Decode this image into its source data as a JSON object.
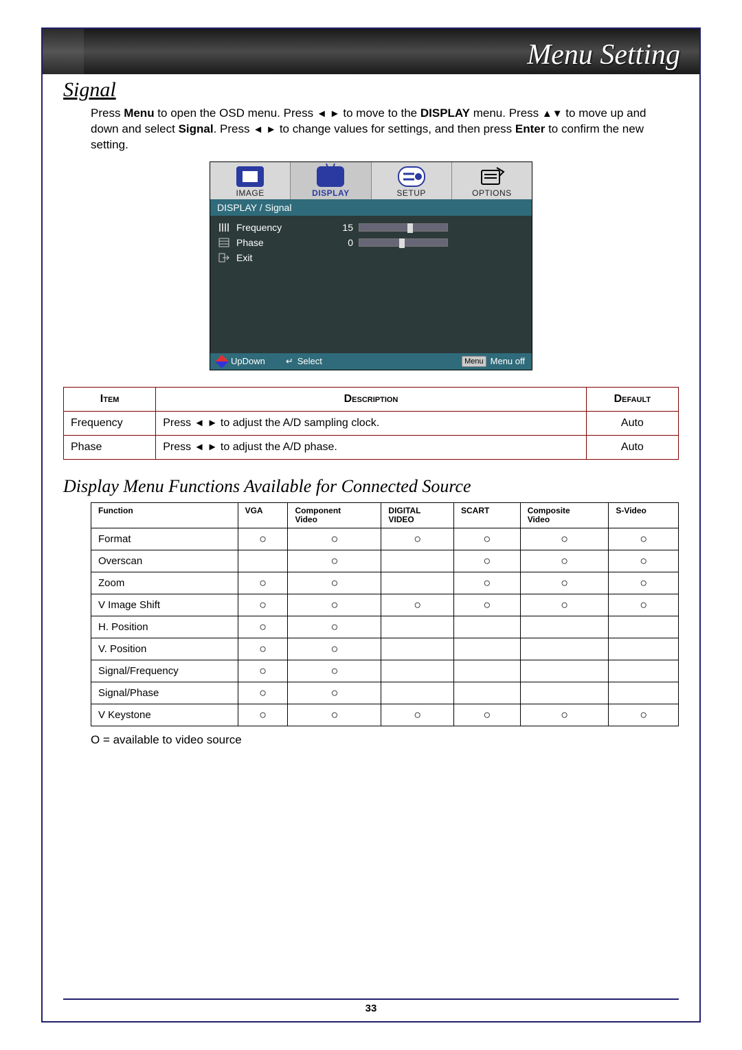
{
  "header": {
    "title": "Menu Setting"
  },
  "section": {
    "title": "Signal"
  },
  "intro": {
    "p1a": "Press ",
    "menu": "Menu",
    "p1b": " to open the OSD menu. Press ",
    "p1c": " to move to the ",
    "display": "DISPLAY",
    "p1d": " menu. Press ",
    "p1e": " to move up and down and select ",
    "signal": "Signal",
    "p1f": ". Press ",
    "p1g": " to change values for settings, and then press ",
    "enter": "Enter",
    "p1h": " to confirm the new setting."
  },
  "osd": {
    "tabs": [
      "IMAGE",
      "DISPLAY",
      "SETUP",
      "OPTIONS"
    ],
    "breadcrumb": "DISPLAY / Signal",
    "rows": [
      {
        "label": "Frequency",
        "value": "15",
        "thumb_pct": 55
      },
      {
        "label": "Phase",
        "value": "0",
        "thumb_pct": 45
      }
    ],
    "exit": "Exit",
    "footer": {
      "updown": "UpDown",
      "select": "Select",
      "menu_btn": "Menu",
      "menuoff": "Menu off"
    }
  },
  "desc_table": {
    "headers": [
      "Item",
      "Description",
      "Default"
    ],
    "rows": [
      {
        "item": "Frequency",
        "desc_a": "Press ",
        "desc_b": " to adjust the A/D sampling clock.",
        "def": "Auto"
      },
      {
        "item": "Phase",
        "desc_a": "Press ",
        "desc_b": " to adjust the A/D phase.",
        "def": "Auto"
      }
    ]
  },
  "subtitle": "Display Menu Functions Available for Connected Source",
  "avail_table": {
    "headers": [
      "Function",
      "VGA",
      "Component Video",
      "DIGITAL VIDEO",
      "SCART",
      "Composite Video",
      "S-Video"
    ],
    "rows": [
      {
        "fn": "Format",
        "cells": [
          "○",
          "○",
          "○",
          "○",
          "○",
          "○"
        ]
      },
      {
        "fn": "Overscan",
        "cells": [
          "",
          "○",
          "",
          "○",
          "○",
          "○"
        ]
      },
      {
        "fn": "Zoom",
        "cells": [
          "○",
          "○",
          "",
          "○",
          "○",
          "○"
        ]
      },
      {
        "fn": "V Image Shift",
        "cells": [
          "○",
          "○",
          "○",
          "○",
          "○",
          "○"
        ]
      },
      {
        "fn": "H. Position",
        "cells": [
          "○",
          "○",
          "",
          "",
          "",
          ""
        ]
      },
      {
        "fn": "V. Position",
        "cells": [
          "○",
          "○",
          "",
          "",
          "",
          ""
        ]
      },
      {
        "fn": "Signal/Frequency",
        "cells": [
          "○",
          "○",
          "",
          "",
          "",
          ""
        ]
      },
      {
        "fn": "Signal/Phase",
        "cells": [
          "○",
          "○",
          "",
          "",
          "",
          ""
        ]
      },
      {
        "fn": "V Keystone",
        "cells": [
          "○",
          "○",
          "○",
          "○",
          "○",
          "○"
        ]
      }
    ]
  },
  "legend": "O = available to video source",
  "page_number": "33",
  "glyphs": {
    "lr": "◄ ►",
    "ud": "▲▼",
    "circle": "○"
  }
}
